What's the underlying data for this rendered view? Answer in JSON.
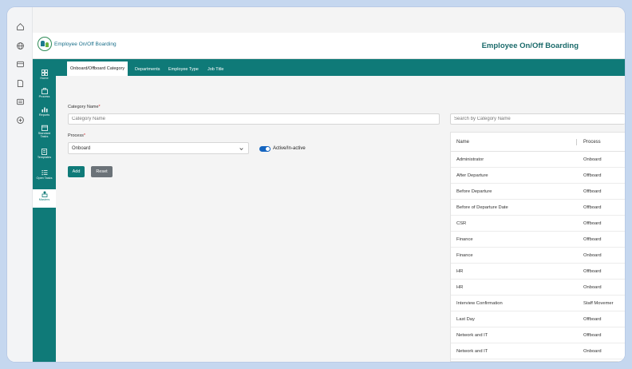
{
  "header": {
    "logo_text": "Employee On/Off Boarding",
    "title": "Employee On/Off Boarding"
  },
  "browser_rail": [
    "home-icon",
    "globe-icon",
    "card-icon",
    "document-icon",
    "list-icon",
    "add-circle-icon"
  ],
  "sidenav": {
    "items": [
      {
        "label": "Home",
        "icon": "grid-icon"
      },
      {
        "label": "Process",
        "icon": "briefcase-icon"
      },
      {
        "label": "Reports",
        "icon": "bar-chart-icon"
      },
      {
        "label": "Standard Tasks",
        "icon": "calendar-icon"
      },
      {
        "label": "Templates",
        "icon": "template-icon"
      },
      {
        "label": "Open Tasks",
        "icon": "list-icon"
      },
      {
        "label": "Masters",
        "icon": "people-icon"
      }
    ]
  },
  "tabs": [
    {
      "label": "Onboard/Offboard Category"
    },
    {
      "label": "Departments"
    },
    {
      "label": "Employee Type"
    },
    {
      "label": "Job Title"
    }
  ],
  "form": {
    "category_label": "Category Name",
    "category_placeholder": "Category Name",
    "process_label": "Process",
    "process_value": "Onboard",
    "toggle_label": "Active/In-active",
    "add_label": "Add",
    "reset_label": "Reset"
  },
  "table": {
    "search_placeholder": "Search by Category Name",
    "columns": [
      "Name",
      "Process"
    ],
    "rows": [
      {
        "name": "Administrator",
        "process": "Onboard"
      },
      {
        "name": "After Departure",
        "process": "Offboard"
      },
      {
        "name": "Before Departure",
        "process": "Offboard"
      },
      {
        "name": "Before of Departure Date",
        "process": "Offboard"
      },
      {
        "name": "CSR",
        "process": "Offboard"
      },
      {
        "name": "Finance",
        "process": "Offboard"
      },
      {
        "name": "Finance",
        "process": "Onboard"
      },
      {
        "name": "HR",
        "process": "Offboard"
      },
      {
        "name": "HR",
        "process": "Onboard"
      },
      {
        "name": "Interview Confirmation",
        "process": "Staff Movemer"
      },
      {
        "name": "Last Day",
        "process": "Offboard"
      },
      {
        "name": "Network and IT",
        "process": "Offboard"
      },
      {
        "name": "Network and IT",
        "process": "Onboard"
      }
    ]
  },
  "colors": {
    "primary": "#0f7a78",
    "toggle": "#1565c0",
    "reset": "#6b7278",
    "required": "#d32f2f"
  }
}
